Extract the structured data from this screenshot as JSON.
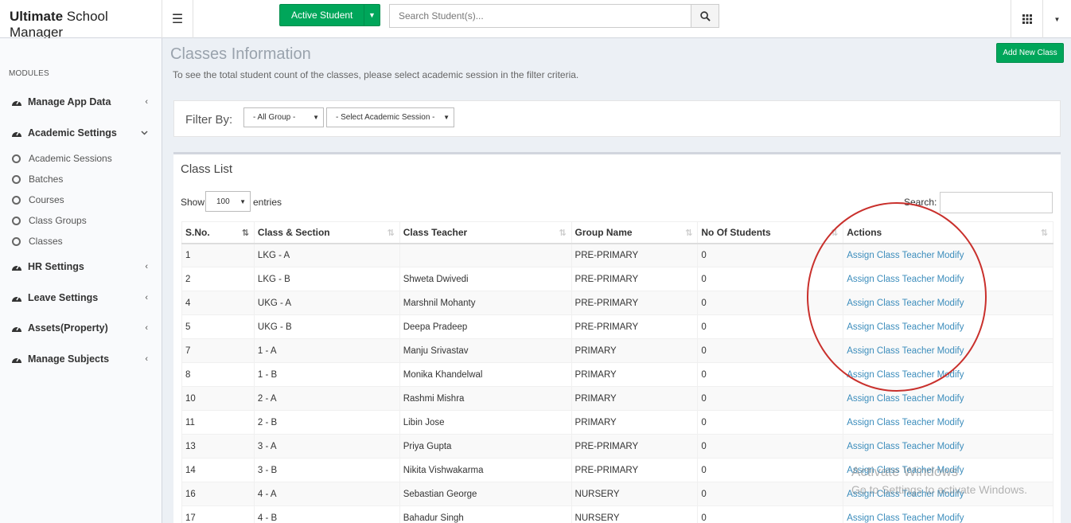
{
  "app": {
    "brand_bold": "Ultimate",
    "brand_rest": " School Manager"
  },
  "topbar": {
    "active_student_label": "Active Student",
    "search_placeholder": "Search Student(s)..."
  },
  "sidebar": {
    "section_label": "MODULES",
    "items": [
      {
        "label": "Manage App Data",
        "icon": "dashboard-icon",
        "chevron": "‹"
      },
      {
        "label": "Academic Settings",
        "icon": "dashboard-icon",
        "chevron": "⌄"
      },
      {
        "label": "HR Settings",
        "icon": "dashboard-icon",
        "chevron": "‹"
      },
      {
        "label": "Leave Settings",
        "icon": "dashboard-icon",
        "chevron": "‹"
      },
      {
        "label": "Assets(Property)",
        "icon": "dashboard-icon",
        "chevron": "‹"
      },
      {
        "label": "Manage Subjects",
        "icon": "dashboard-icon",
        "chevron": "‹"
      }
    ],
    "sub_items": [
      "Academic Sessions",
      "Batches",
      "Courses",
      "Class Groups",
      "Classes"
    ]
  },
  "page": {
    "title": "Classes Information",
    "subtitle": "To see the total student count of the classes, please select academic session in the filter criteria.",
    "add_button": "Add New Class"
  },
  "filter": {
    "label": "Filter By:",
    "group_select": "- All Group -",
    "session_select": "- Select Academic Session -"
  },
  "list": {
    "title": "Class List",
    "show_label": "Show",
    "entries_value": "100",
    "entries_label": "entries",
    "search_label": "Search:",
    "columns": [
      "S.No.",
      "Class & Section",
      "Class Teacher",
      "Group Name",
      "No Of Students",
      "Actions"
    ],
    "action_assign": "Assign Class Teacher",
    "action_modify": "Modify",
    "rows": [
      {
        "sno": "1",
        "cls": "LKG - A",
        "teacher": "",
        "group": "PRE-PRIMARY",
        "count": "0"
      },
      {
        "sno": "2",
        "cls": "LKG - B",
        "teacher": "Shweta Dwivedi",
        "group": "PRE-PRIMARY",
        "count": "0"
      },
      {
        "sno": "4",
        "cls": "UKG - A",
        "teacher": "Marshnil Mohanty",
        "group": "PRE-PRIMARY",
        "count": "0"
      },
      {
        "sno": "5",
        "cls": "UKG - B",
        "teacher": "Deepa Pradeep",
        "group": "PRE-PRIMARY",
        "count": "0"
      },
      {
        "sno": "7",
        "cls": "1 - A",
        "teacher": "Manju Srivastav",
        "group": "PRIMARY",
        "count": "0"
      },
      {
        "sno": "8",
        "cls": "1 - B",
        "teacher": "Monika Khandelwal",
        "group": "PRIMARY",
        "count": "0"
      },
      {
        "sno": "10",
        "cls": "2 - A",
        "teacher": "Rashmi Mishra",
        "group": "PRIMARY",
        "count": "0"
      },
      {
        "sno": "11",
        "cls": "2 - B",
        "teacher": "Libin Jose",
        "group": "PRIMARY",
        "count": "0"
      },
      {
        "sno": "13",
        "cls": "3 - A",
        "teacher": "Priya Gupta",
        "group": "PRE-PRIMARY",
        "count": "0"
      },
      {
        "sno": "14",
        "cls": "3 - B",
        "teacher": "Nikita Vishwakarma",
        "group": "PRE-PRIMARY",
        "count": "0"
      },
      {
        "sno": "16",
        "cls": "4 - A",
        "teacher": "Sebastian George",
        "group": "NURSERY",
        "count": "0"
      },
      {
        "sno": "17",
        "cls": "4 - B",
        "teacher": "Bahadur Singh",
        "group": "NURSERY",
        "count": "0"
      }
    ]
  },
  "watermark": {
    "line1": "Activate Windows",
    "line2": "Go to Settings to activate Windows."
  },
  "colors": {
    "accent_green": "#00a65a",
    "link_blue": "#3c8dbc",
    "annotation_red": "#c9302c"
  }
}
